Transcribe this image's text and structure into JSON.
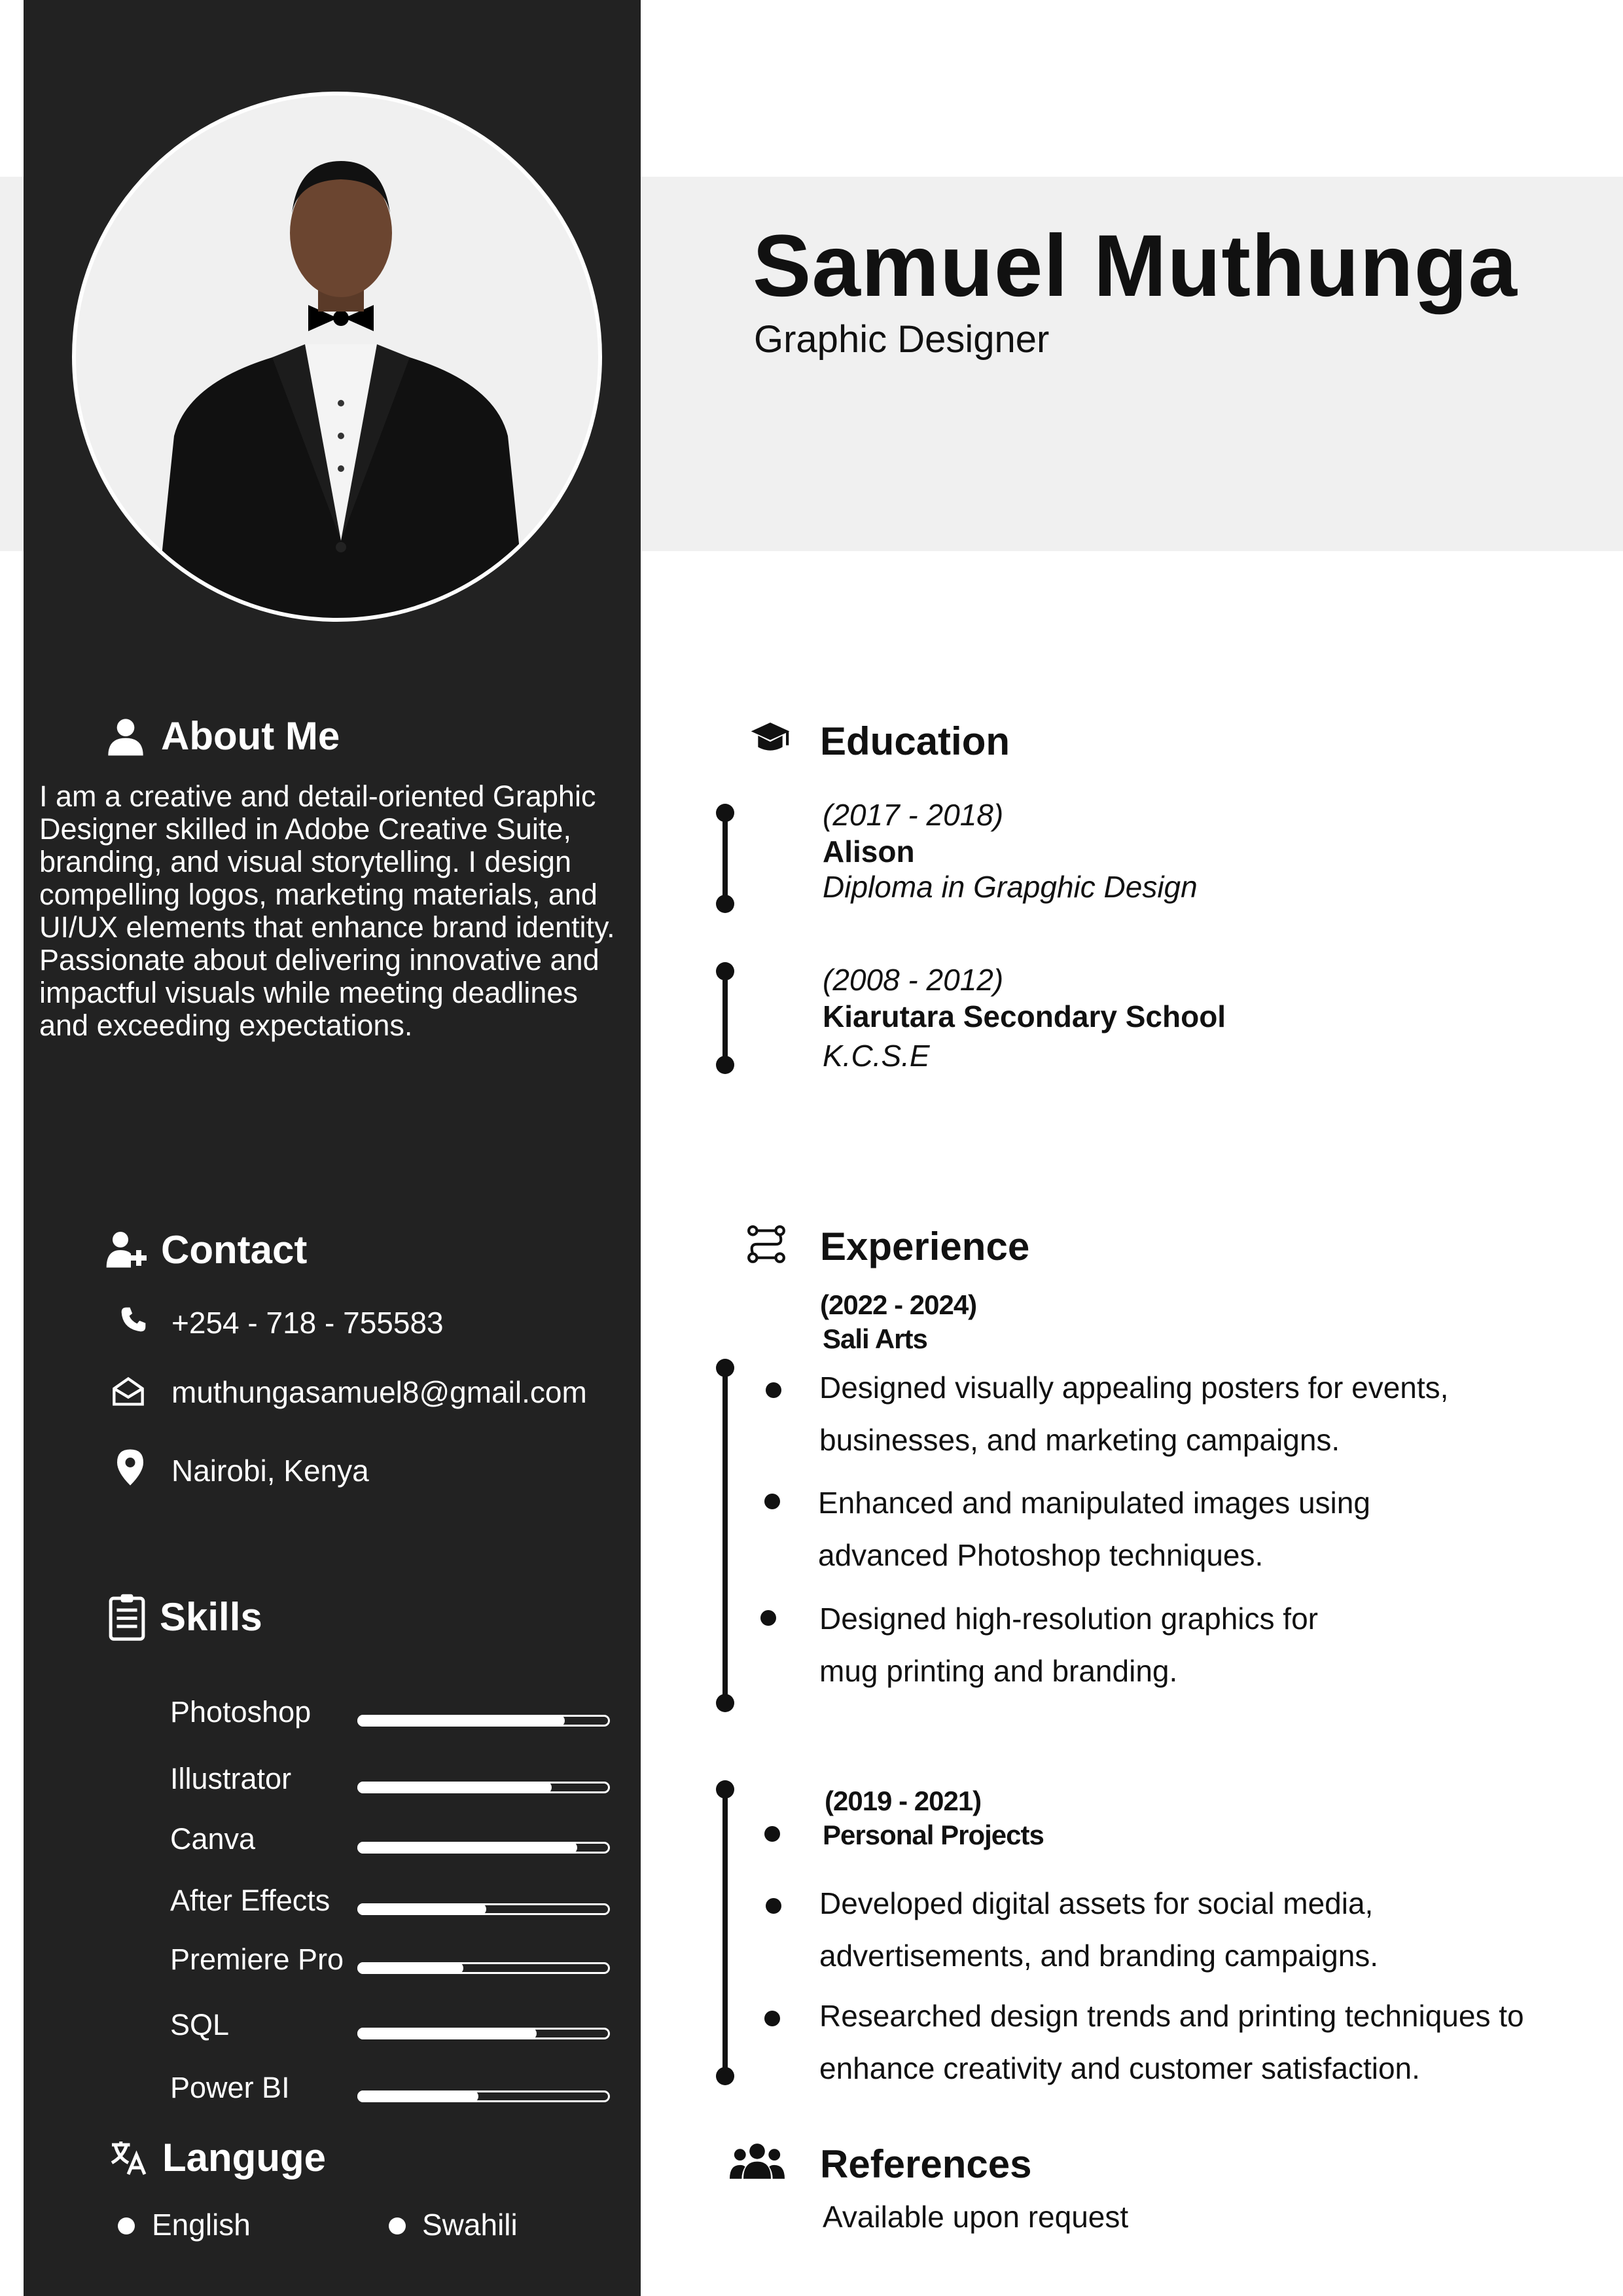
{
  "header": {
    "name": "Samuel Muthunga",
    "role": "Graphic Designer"
  },
  "about": {
    "heading": "About Me",
    "icon": "user-icon",
    "text": "I am a creative and detail-oriented Graphic Designer skilled in Adobe Creative Suite, branding, and visual storytelling. I design compelling logos, marketing materials, and UI/UX elements that enhance brand identity. Passionate about delivering innovative and impactful visuals while meeting deadlines and exceeding expectations."
  },
  "contact": {
    "heading": "Contact",
    "icon": "user-plus-icon",
    "phone": "+254 - 718 - 755583",
    "email": "muthungasamuel8@gmail.com",
    "location": "Nairobi, Kenya"
  },
  "skills": {
    "heading": "Skills",
    "icon": "clipboard-list-icon",
    "items": [
      {
        "label": "Photoshop",
        "level": 0.82
      },
      {
        "label": "Illustrator",
        "level": 0.77
      },
      {
        "label": "Canva",
        "level": 0.87
      },
      {
        "label": "After Effects",
        "level": 0.51
      },
      {
        "label": "Premiere Pro",
        "level": 0.42
      },
      {
        "label": "SQL",
        "level": 0.71
      },
      {
        "label": "Power BI",
        "level": 0.48
      }
    ]
  },
  "language": {
    "heading": "Languge",
    "icon": "translate-icon",
    "items": [
      "English",
      "Swahili"
    ]
  },
  "education": {
    "heading": "Education",
    "icon": "graduation-cap-icon",
    "entries": [
      {
        "years": "(2017 - 2018)",
        "school": "Alison",
        "award": "Diploma in Grapghic Design"
      },
      {
        "years": "(2008 - 2012)",
        "school": "Kiarutara Secondary School",
        "award": "K.C.S.E"
      }
    ]
  },
  "experience": {
    "heading": "Experience",
    "icon": "workflow-icon",
    "entries": [
      {
        "years": "(2022 - 2024)",
        "company": "Sali Arts",
        "bullets": [
          "Designed visually appealing posters for events, businesses, and marketing campaigns.",
          "Enhanced and manipulated images using advanced Photoshop techniques.",
          "Designed high-resolution graphics for mug printing and branding."
        ]
      },
      {
        "years": "(2019 - 2021)",
        "company": "Personal Projects",
        "bullets": [
          "Developed digital assets for social media, advertisements, and branding campaigns.",
          "Researched design trends and printing techniques to enhance creativity and customer satisfaction."
        ]
      }
    ]
  },
  "references": {
    "heading": "References",
    "icon": "users-icon",
    "text": "Available upon request"
  },
  "colors": {
    "sidebar": "#222222",
    "band": "#f0f0f0",
    "text": "#111111",
    "sidebar_text": "#ffffff"
  }
}
